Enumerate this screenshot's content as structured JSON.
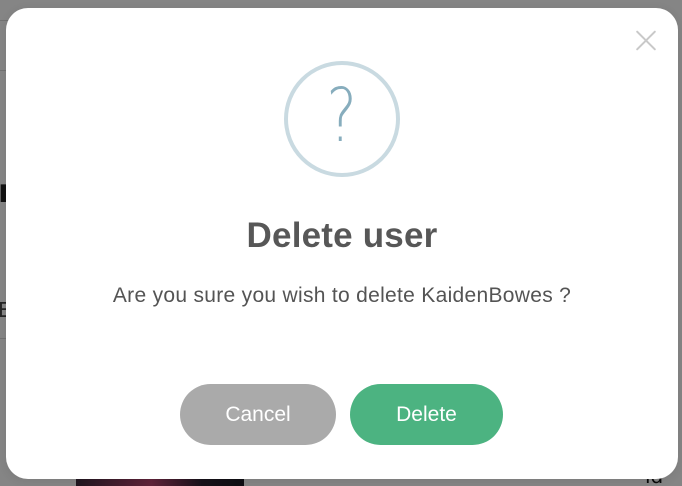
{
  "background": {
    "fragments": [
      "n",
      "E",
      "ld"
    ]
  },
  "dialog": {
    "icon": "question-mark-icon",
    "icon_glyph": "?",
    "title": "Delete user",
    "message": "Are you sure you wish to delete KaidenBowes ?",
    "cancel_label": "Cancel",
    "delete_label": "Delete",
    "colors": {
      "cancel": "#aaaaaa",
      "delete": "#4cb381",
      "icon": "#87adbd"
    }
  }
}
